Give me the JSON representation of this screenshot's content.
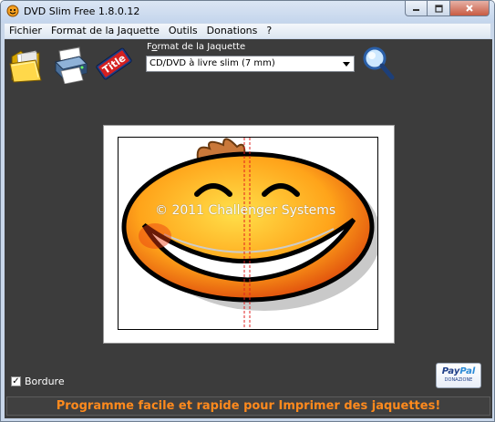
{
  "window": {
    "title": "DVD Slim Free 1.8.0.12"
  },
  "menu": {
    "items": [
      "Fichier",
      "Format de la Jaquette",
      "Outils",
      "Donations",
      "?"
    ]
  },
  "toolbar": {
    "icons": [
      "open-folder-icon",
      "print-icon",
      "title-icon"
    ],
    "format_label_prefix": "F",
    "format_label_underline": "o",
    "format_label_rest": "rmat de la Jaquette",
    "format_selected": "CD/DVD à livre slim (7 mm)"
  },
  "preview": {
    "watermark": "© 2011 Challenger Systems"
  },
  "options": {
    "border_label": "Bordure",
    "border_checked": true,
    "checkmark": "✓"
  },
  "donate": {
    "pay": "Pay",
    "pal": "Pal",
    "sub": "DONAZIONE"
  },
  "status": {
    "text": "Programme facile et rapide pour Imprimer des jaquettes!"
  },
  "colors": {
    "background": "#3c3c3c",
    "status_text": "#ff8a1d",
    "titlebar": "#c9d7ea"
  }
}
